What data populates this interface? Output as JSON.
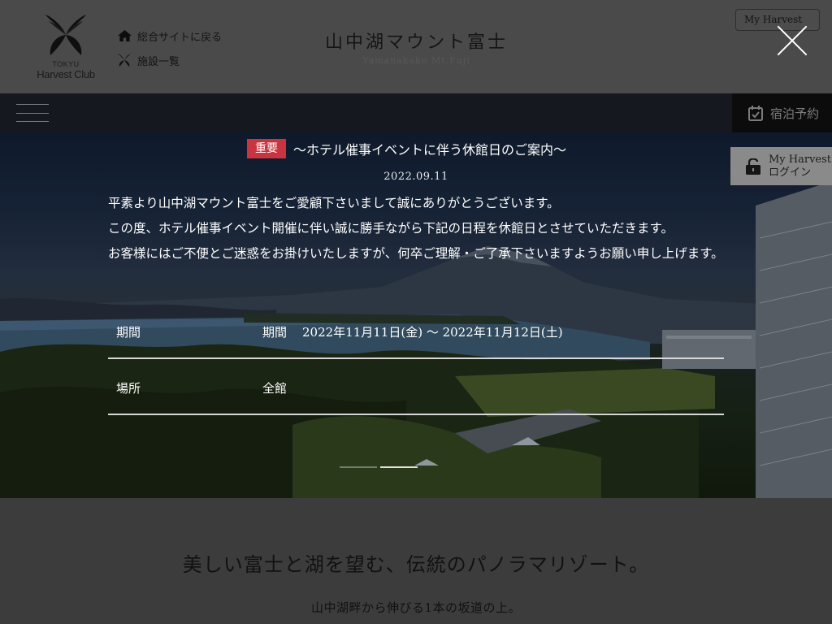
{
  "header": {
    "logo": {
      "sub": "TOKYU",
      "main": "Harvest Club"
    },
    "links": [
      {
        "icon": "home-icon",
        "label": "総合サイトに戻る"
      },
      {
        "icon": "butterfly-icon",
        "label": "施設一覧"
      }
    ],
    "site_title": "山中湖マウント富士",
    "site_title_en": "Yamanakako Mt.Fuji",
    "my_harvest_label": "My Harvest"
  },
  "navbar": {
    "booking_label": "宿泊予約"
  },
  "login": {
    "line1": "My Harvest",
    "line2": "ログイン"
  },
  "notice": {
    "badge": "重要",
    "title": "〜ホテル催事イベントに伴う休館日のご案内〜",
    "date": "2022.09.11",
    "body": [
      "平素より山中湖マウント富士をご愛顧下さいまして誠にありがとうございます。",
      "この度、ホテル催事イベント開催に伴い誠に勝手ながら下記の日程を休館日とさせていただきます。",
      "お客様にはご不便とご迷惑をお掛けいたしますが、何卒ご理解・ご了承下さいますようお願い申し上げます。"
    ],
    "table": [
      {
        "label": "期間",
        "value_label": "期間",
        "value": "2022年11月11日(金) 〜 2022年11月12日(土)"
      },
      {
        "label": "場所",
        "value": "全館"
      }
    ]
  },
  "slider": {
    "total": 2,
    "current": 2
  },
  "intro": {
    "heading": "美しい富士と湖を望む、伝統のパノラマリゾート。",
    "text": "山中湖畔から伸びる1本の坂道の上。"
  },
  "colors": {
    "badge": "#c9343e",
    "navbar": "#161820",
    "booking": "#0c0c0c"
  }
}
